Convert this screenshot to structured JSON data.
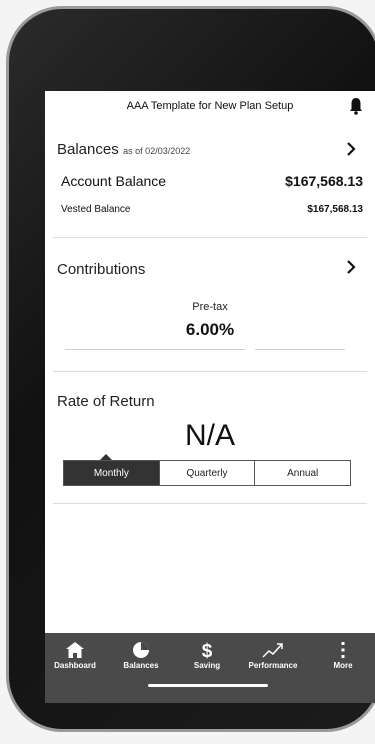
{
  "header": {
    "title": "AAA Template for New Plan Setup"
  },
  "balances": {
    "title": "Balances",
    "as_of": "as of 02/03/2022",
    "account_label": "Account Balance",
    "account_value": "$167,568.13",
    "vested_label": "Vested Balance",
    "vested_value": "$167,568.13"
  },
  "contributions": {
    "title": "Contributions",
    "pretax_label": "Pre-tax",
    "pretax_value": "6.00%"
  },
  "rate_of_return": {
    "title": "Rate of Return",
    "value": "N/A",
    "options": [
      "Monthly",
      "Quarterly",
      "Annual"
    ],
    "selected": "Monthly"
  },
  "tabbar": {
    "items": [
      {
        "label": "Dashboard",
        "icon": "home-icon"
      },
      {
        "label": "Balances",
        "icon": "pie-chart-icon"
      },
      {
        "label": "Saving",
        "icon": "dollar-icon"
      },
      {
        "label": "Performance",
        "icon": "trend-icon"
      },
      {
        "label": "More",
        "icon": "more-vertical-icon"
      }
    ]
  },
  "colors": {
    "tabbar_bg": "#4a4a4a",
    "selected_segment": "#333333"
  }
}
